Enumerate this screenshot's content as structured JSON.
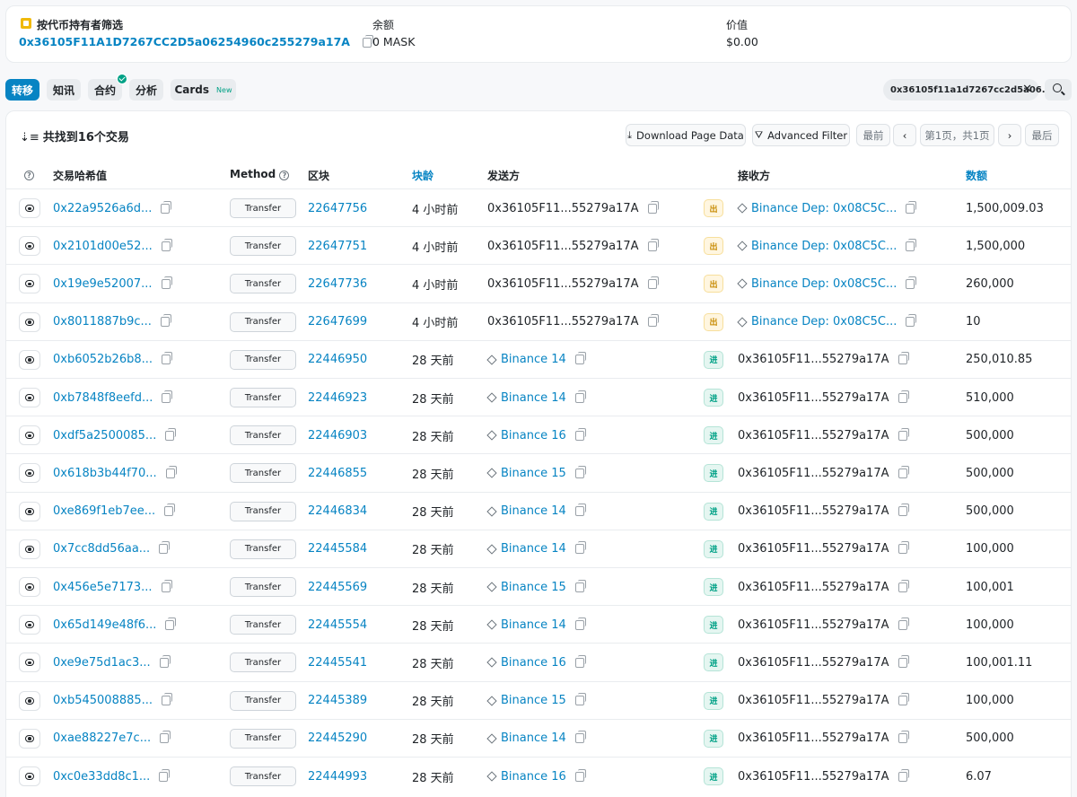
{
  "summary": {
    "filter_label": "按代币持有者筛选",
    "address": "0x36105F11A1D7267CC2D5a06254960c255279a17A",
    "balance_label": "余额",
    "balance_value": "0 MASK",
    "value_label": "价值",
    "value_value": "$0.00"
  },
  "tabs": [
    {
      "label": "转移",
      "active": true
    },
    {
      "label": "知讯"
    },
    {
      "label": "合约",
      "verified": true
    },
    {
      "label": "分析"
    },
    {
      "label": "Cards",
      "badge": "New"
    }
  ],
  "filter_chip": {
    "text": "0x36105f11a1d7267cc2d5a06...",
    "close": "✕"
  },
  "table": {
    "found_text": "共找到16个交易",
    "buttons": {
      "download": "Download Page Data",
      "advanced_filter": "Advanced Filter",
      "first": "最前",
      "prev": "‹",
      "page_info": "第1页，共1页",
      "next": "›",
      "last": "最后"
    },
    "headers": {
      "txhash": "交易哈希值",
      "method": "Method",
      "block": "区块",
      "age": "块龄",
      "from": "发送方",
      "to": "接收方",
      "amount": "数额"
    },
    "rows": [
      {
        "hash": "0x22a9526a6d...",
        "method": "Transfer",
        "block": "22647756",
        "age": "4 小时前",
        "from": "0x36105F11...55279a17A",
        "dir": "出",
        "to": "Binance Dep: 0x08C5C...",
        "amount": "1,500,009.03"
      },
      {
        "hash": "0x2101d00e52...",
        "method": "Transfer",
        "block": "22647751",
        "age": "4 小时前",
        "from": "0x36105F11...55279a17A",
        "dir": "出",
        "to": "Binance Dep: 0x08C5C...",
        "amount": "1,500,000"
      },
      {
        "hash": "0x19e9e52007...",
        "method": "Transfer",
        "block": "22647736",
        "age": "4 小时前",
        "from": "0x36105F11...55279a17A",
        "dir": "出",
        "to": "Binance Dep: 0x08C5C...",
        "amount": "260,000"
      },
      {
        "hash": "0x8011887b9c...",
        "method": "Transfer",
        "block": "22647699",
        "age": "4 小时前",
        "from": "0x36105F11...55279a17A",
        "dir": "出",
        "to": "Binance Dep: 0x08C5C...",
        "amount": "10"
      },
      {
        "hash": "0xb6052b26b8...",
        "method": "Transfer",
        "block": "22446950",
        "age": "28 天前",
        "from": "Binance 14",
        "dir": "进",
        "to": "0x36105F11...55279a17A",
        "amount": "250,010.85"
      },
      {
        "hash": "0xb7848f8eefd...",
        "method": "Transfer",
        "block": "22446923",
        "age": "28 天前",
        "from": "Binance 14",
        "dir": "进",
        "to": "0x36105F11...55279a17A",
        "amount": "510,000"
      },
      {
        "hash": "0xdf5a2500085...",
        "method": "Transfer",
        "block": "22446903",
        "age": "28 天前",
        "from": "Binance 16",
        "dir": "进",
        "to": "0x36105F11...55279a17A",
        "amount": "500,000"
      },
      {
        "hash": "0x618b3b44f70...",
        "method": "Transfer",
        "block": "22446855",
        "age": "28 天前",
        "from": "Binance 15",
        "dir": "进",
        "to": "0x36105F11...55279a17A",
        "amount": "500,000"
      },
      {
        "hash": "0xe869f1eb7ee...",
        "method": "Transfer",
        "block": "22446834",
        "age": "28 天前",
        "from": "Binance 14",
        "dir": "进",
        "to": "0x36105F11...55279a17A",
        "amount": "500,000"
      },
      {
        "hash": "0x7cc8dd56aa...",
        "method": "Transfer",
        "block": "22445584",
        "age": "28 天前",
        "from": "Binance 14",
        "dir": "进",
        "to": "0x36105F11...55279a17A",
        "amount": "100,000"
      },
      {
        "hash": "0x456e5e7173...",
        "method": "Transfer",
        "block": "22445569",
        "age": "28 天前",
        "from": "Binance 15",
        "dir": "进",
        "to": "0x36105F11...55279a17A",
        "amount": "100,001"
      },
      {
        "hash": "0x65d149e48f6...",
        "method": "Transfer",
        "block": "22445554",
        "age": "28 天前",
        "from": "Binance 14",
        "dir": "进",
        "to": "0x36105F11...55279a17A",
        "amount": "100,000"
      },
      {
        "hash": "0xe9e75d1ac3...",
        "method": "Transfer",
        "block": "22445541",
        "age": "28 天前",
        "from": "Binance 16",
        "dir": "进",
        "to": "0x36105F11...55279a17A",
        "amount": "100,001.11"
      },
      {
        "hash": "0xb545008885...",
        "method": "Transfer",
        "block": "22445389",
        "age": "28 天前",
        "from": "Binance 15",
        "dir": "进",
        "to": "0x36105F11...55279a17A",
        "amount": "100,000"
      },
      {
        "hash": "0xae88227e7c...",
        "method": "Transfer",
        "block": "22445290",
        "age": "28 天前",
        "from": "Binance 14",
        "dir": "进",
        "to": "0x36105F11...55279a17A",
        "amount": "500,000"
      },
      {
        "hash": "0xc0e33dd8c1...",
        "method": "Transfer",
        "block": "22444993",
        "age": "28 天前",
        "from": "Binance 16",
        "dir": "进",
        "to": "0x36105F11...55279a17A",
        "amount": "6.07"
      }
    ]
  },
  "colors": {
    "link": "#0784c3",
    "active_tab": "#0784c3",
    "out_badge": "#c78a00",
    "in_badge": "#00a186"
  },
  "icons": [
    "token-icon",
    "copy-icon",
    "sort-icon",
    "download-icon",
    "filter-icon",
    "question-icon",
    "eye-icon",
    "contract-icon",
    "search-icon",
    "close-icon",
    "verified-check-icon"
  ]
}
